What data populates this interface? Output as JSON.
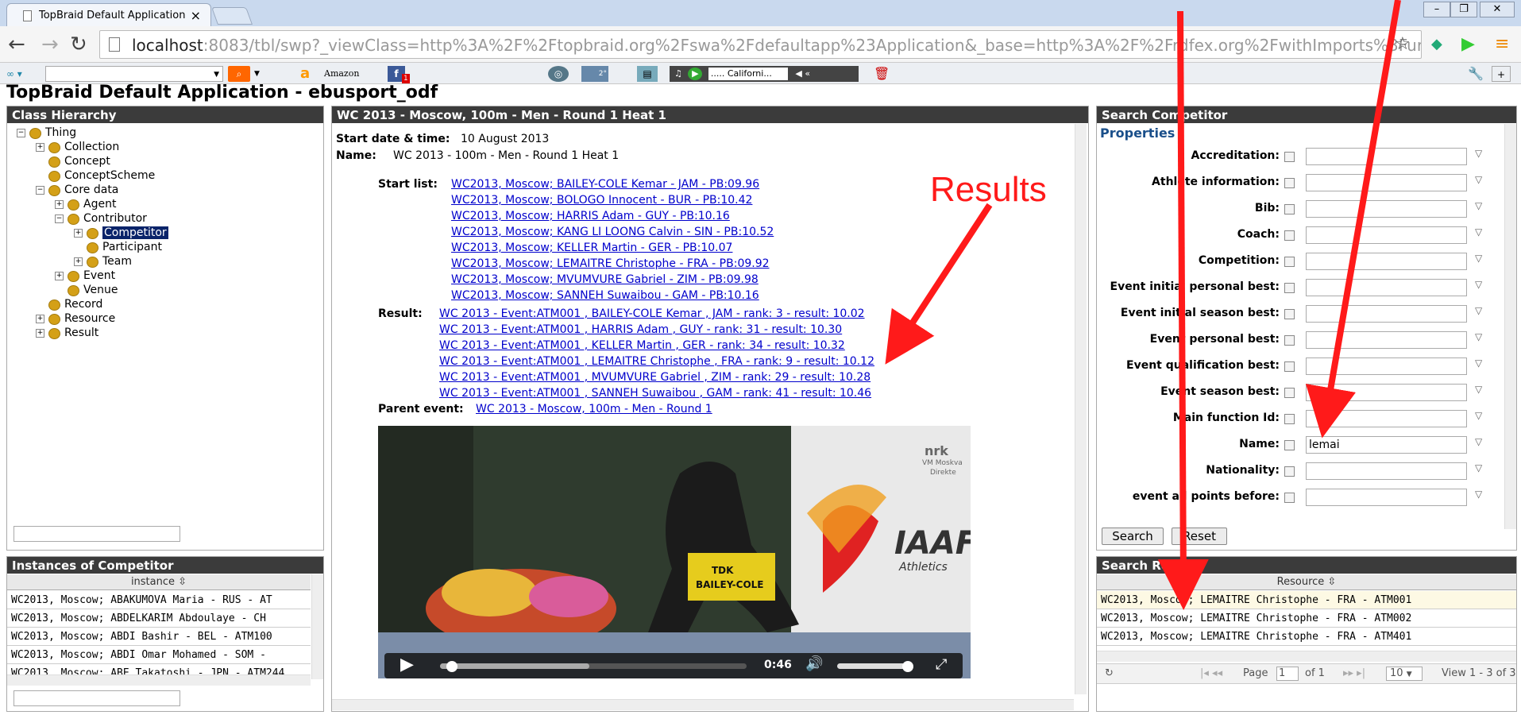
{
  "browser": {
    "tab_title": "TopBraid Default Application",
    "tab_close": "×",
    "url_host": "localhost",
    "url_rest": ":8083/tbl/swp?_viewClass=http%3A%2F%2Ftopbraid.org%2Fswa%2Fdefaultapp%23Application&_base=http%3A%2F%2Frdfex.org%2FwithImports%3Furi",
    "toolbar": {
      "amazon": "Amazon",
      "fb_badge": "1",
      "weather_badge": "2°",
      "radio": "..... Californi..."
    }
  },
  "app": {
    "title": "TopBraid Default Application - ebusport_odf",
    "class_hierarchy": {
      "title": "Class Hierarchy",
      "nodes": [
        "Thing",
        "Collection",
        "Concept",
        "ConceptScheme",
        "Core data",
        "Agent",
        "Contributor",
        "Competitor",
        "Participant",
        "Team",
        "Event",
        "Venue",
        "Record",
        "Resource",
        "Result"
      ]
    },
    "instances": {
      "title": "Instances of Competitor",
      "column": "instance",
      "rows": [
        "WC2013, Moscow; ABAKUMOVA Maria - RUS - AT",
        "WC2013, Moscow; ABDELKARIM Abdoulaye - CH",
        "WC2013, Moscow; ABDI Bashir - BEL - ATM100",
        "WC2013, Moscow; ABDI Omar Mohamed - SOM -",
        "WC2013, Moscow; ABE Takatoshi - JPN - ATM244"
      ]
    },
    "detail": {
      "title": "WC 2013 - Moscow, 100m - Men - Round 1 Heat 1",
      "start_label": "Start date & time:",
      "start_value": "10 August 2013",
      "name_label": "Name:",
      "name_value": "WC 2013 - 100m - Men - Round 1 Heat 1",
      "startlist_label": "Start list:",
      "startlist": [
        "WC2013, Moscow; BAILEY-COLE Kemar - JAM - PB:09.96",
        "WC2013, Moscow; BOLOGO Innocent - BUR - PB:10.42",
        "WC2013, Moscow; HARRIS Adam - GUY - PB:10.16",
        "WC2013, Moscow; KANG LI LOONG Calvin - SIN - PB:10.52",
        "WC2013, Moscow; KELLER Martin - GER - PB:10.07",
        "WC2013, Moscow; LEMAITRE Christophe - FRA - PB:09.92",
        "WC2013, Moscow; MVUMVURE Gabriel - ZIM - PB:09.98",
        "WC2013, Moscow; SANNEH Suwaibou - GAM - PB:10.16"
      ],
      "result_label": "Result:",
      "results": [
        "WC 2013 - Event:ATM001 , BAILEY-COLE Kemar , JAM - rank: 3 - result: 10.02",
        "WC 2013 - Event:ATM001 , HARRIS Adam , GUY - rank: 31 - result: 10.30",
        "WC 2013 - Event:ATM001 , KELLER Martin , GER - rank: 34 - result: 10.32",
        "WC 2013 - Event:ATM001 , LEMAITRE Christophe , FRA - rank: 9 - result: 10.12",
        "WC 2013 - Event:ATM001 , MVUMVURE Gabriel , ZIM - rank: 29 - result: 10.28",
        "WC 2013 - Event:ATM001 , SANNEH Suwaibou , GAM - rank: 41 - result: 10.46"
      ],
      "parent_label": "Parent event:",
      "parent_value": "WC 2013 - Moscow, 100m - Men - Round 1",
      "video": {
        "time": "0:46",
        "progress": 0.02,
        "nrk": "nrk",
        "nrk_sub1": "VM Moskva",
        "nrk_sub2": "Direkte",
        "iaaf": "IAAF",
        "athletics": "Athletics",
        "bib": "BAILEY-COLE",
        "sponsor": "TDK"
      }
    },
    "search": {
      "title": "Search Competitor",
      "properties_heading": "Properties",
      "fields": [
        {
          "label": "Accreditation:",
          "value": ""
        },
        {
          "label": "Athlete information:",
          "value": ""
        },
        {
          "label": "Bib:",
          "value": ""
        },
        {
          "label": "Coach:",
          "value": ""
        },
        {
          "label": "Competition:",
          "value": ""
        },
        {
          "label": "Event initial personal best:",
          "value": ""
        },
        {
          "label": "Event initial season best:",
          "value": ""
        },
        {
          "label": "Event personal best:",
          "value": ""
        },
        {
          "label": "Event qualification best:",
          "value": ""
        },
        {
          "label": "Event season best:",
          "value": ""
        },
        {
          "label": "Main function Id:",
          "value": ""
        },
        {
          "label": "Name:",
          "value": "lemai"
        },
        {
          "label": "Nationality:",
          "value": ""
        },
        {
          "label": "event all points before:",
          "value": ""
        }
      ],
      "search_btn": "Search",
      "reset_btn": "Reset"
    },
    "search_results": {
      "title": "Search Results",
      "column": "Resource",
      "rows": [
        "WC2013, Moscow; LEMAITRE Christophe - FRA - ATM001",
        "WC2013, Moscow; LEMAITRE Christophe - FRA - ATM002",
        "WC2013, Moscow; LEMAITRE Christophe - FRA - ATM401"
      ],
      "pager": {
        "page_label": "Page",
        "page_value": "1",
        "of": "of 1",
        "per_page": "10",
        "view": "View 1 - 3 of 3"
      }
    },
    "annotation": {
      "text": "Results",
      "color": "#ff1a1a"
    }
  }
}
